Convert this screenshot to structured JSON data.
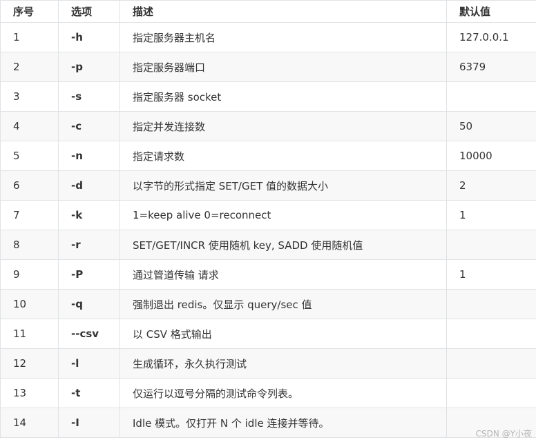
{
  "table": {
    "headers": [
      "序号",
      "选项",
      "描述",
      "默认值"
    ],
    "rows": [
      {
        "index": "1",
        "option": "-h",
        "description": "指定服务器主机名",
        "default": "127.0.0.1"
      },
      {
        "index": "2",
        "option": "-p",
        "description": "指定服务器端口",
        "default": "6379"
      },
      {
        "index": "3",
        "option": "-s",
        "description": "指定服务器 socket",
        "default": ""
      },
      {
        "index": "4",
        "option": "-c",
        "description": "指定并发连接数",
        "default": "50"
      },
      {
        "index": "5",
        "option": "-n",
        "description": "指定请求数",
        "default": "10000"
      },
      {
        "index": "6",
        "option": "-d",
        "description": "以字节的形式指定 SET/GET 值的数据大小",
        "default": "2"
      },
      {
        "index": "7",
        "option": "-k",
        "description": "1=keep alive 0=reconnect",
        "default": "1"
      },
      {
        "index": "8",
        "option": "-r",
        "description": "SET/GET/INCR 使用随机 key, SADD 使用随机值",
        "default": ""
      },
      {
        "index": "9",
        "option": "-P",
        "description": "通过管道传输 请求",
        "default": "1"
      },
      {
        "index": "10",
        "option": "-q",
        "description": "强制退出 redis。仅显示 query/sec 值",
        "default": ""
      },
      {
        "index": "11",
        "option": "--csv",
        "description": "以 CSV 格式输出",
        "default": ""
      },
      {
        "index": "12",
        "option": "-l",
        "description": "生成循环，永久执行测试",
        "default": ""
      },
      {
        "index": "13",
        "option": "-t",
        "description": "仅运行以逗号分隔的测试命令列表。",
        "default": ""
      },
      {
        "index": "14",
        "option": "-I",
        "description": "Idle 模式。仅打开 N 个 idle 连接并等待。",
        "default": ""
      }
    ]
  },
  "watermark": "CSDN @Y小夜"
}
